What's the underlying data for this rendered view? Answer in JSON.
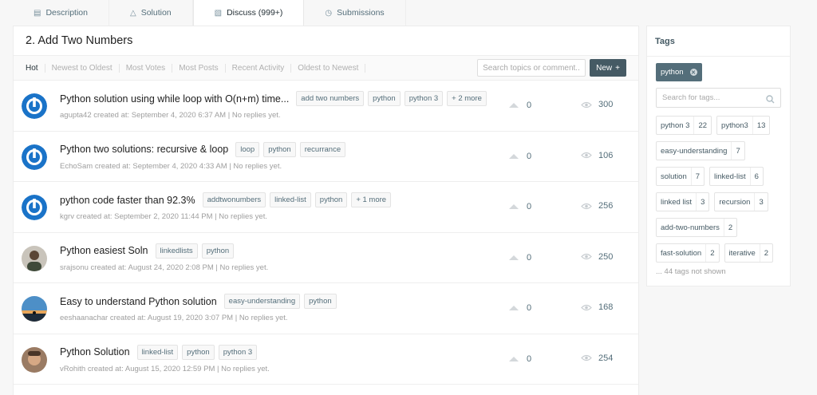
{
  "tabs": [
    {
      "label": "Description",
      "icon": "document-icon"
    },
    {
      "label": "Solution",
      "icon": "flask-icon"
    },
    {
      "label": "Discuss (999+)",
      "icon": "chat-icon"
    },
    {
      "label": "Submissions",
      "icon": "clock-icon"
    }
  ],
  "problem_title": "2. Add Two Numbers",
  "filters": [
    "Hot",
    "Newest to Oldest",
    "Most Votes",
    "Most Posts",
    "Recent Activity",
    "Oldest to Newest"
  ],
  "search_placeholder": "Search topics or comment...",
  "new_button": "New",
  "new_button_icon": "+",
  "posts": [
    {
      "title": "Python solution using while loop with O(n+m) time...",
      "tags": [
        "add two numbers",
        "python",
        "python 3",
        "+ 2 more"
      ],
      "meta": "agupta42 created at: September 4, 2020 6:37 AM | No replies yet.",
      "votes": "0",
      "views": "300",
      "avatar": "default"
    },
    {
      "title": "Python two solutions: recursive & loop",
      "tags": [
        "loop",
        "python",
        "recurrance"
      ],
      "meta": "EchoSam created at: September 4, 2020 4:33 AM | No replies yet.",
      "votes": "0",
      "views": "106",
      "avatar": "default"
    },
    {
      "title": "python code faster than 92.3%",
      "tags": [
        "addtwonumbers",
        "linked-list",
        "python",
        "+ 1 more"
      ],
      "meta": "kgrv created at: September 2, 2020 11:44 PM | No replies yet.",
      "votes": "0",
      "views": "256",
      "avatar": "default"
    },
    {
      "title": "Python easiest Soln",
      "tags": [
        "linkedlists",
        "python"
      ],
      "meta": "srajsonu created at: August 24, 2020 2:08 PM | No replies yet.",
      "votes": "0",
      "views": "250",
      "avatar": "photo-person"
    },
    {
      "title": "Easy to understand Python solution",
      "tags": [
        "easy-understanding",
        "python"
      ],
      "meta": "eeshaanachar created at: August 19, 2020 3:07 PM | No replies yet.",
      "votes": "0",
      "views": "168",
      "avatar": "photo-landscape"
    },
    {
      "title": "Python Solution",
      "tags": [
        "linked-list",
        "python",
        "python 3"
      ],
      "meta": "vRohith created at: August 15, 2020 12:59 PM | No replies yet.",
      "votes": "0",
      "views": "254",
      "avatar": "photo-face"
    }
  ],
  "sidebar": {
    "title": "Tags",
    "selected_tag": "python",
    "search_placeholder": "Search for tags...",
    "tags": [
      {
        "name": "python 3",
        "count": "22"
      },
      {
        "name": "python3",
        "count": "13"
      },
      {
        "name": "easy-understanding",
        "count": "7"
      },
      {
        "name": "solution",
        "count": "7"
      },
      {
        "name": "linked-list",
        "count": "6"
      },
      {
        "name": "linked list",
        "count": "3"
      },
      {
        "name": "recursion",
        "count": "3"
      },
      {
        "name": "add-two-numbers",
        "count": "2"
      },
      {
        "name": "fast-solution",
        "count": "2"
      },
      {
        "name": "iterative",
        "count": "2"
      }
    ],
    "not_shown": "... 44 tags not shown"
  },
  "colors": {
    "accent": "#455a64",
    "default_avatar": "#1a73c8"
  }
}
